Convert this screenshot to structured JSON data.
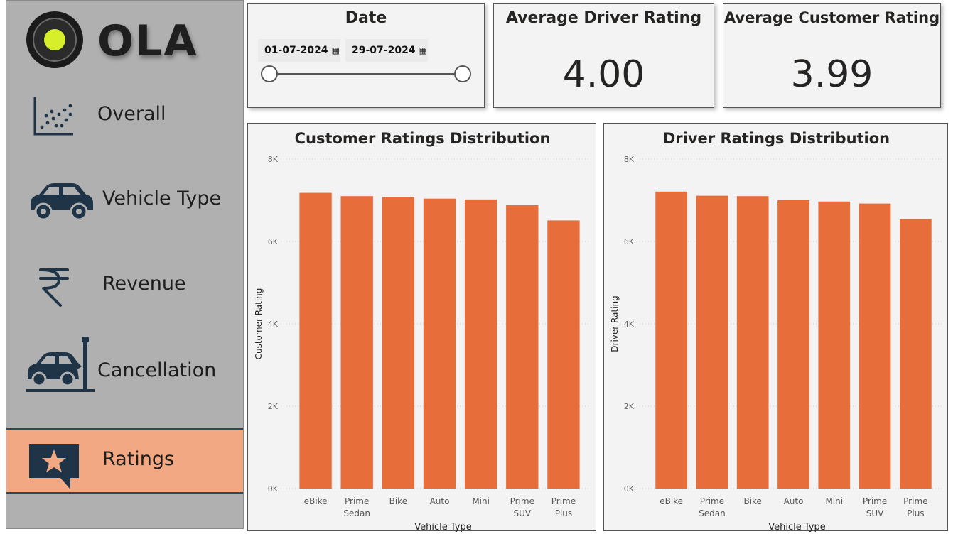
{
  "brand": {
    "name": "OLA"
  },
  "nav": {
    "items": [
      {
        "label": "Overall",
        "icon": "scatter-chart-icon"
      },
      {
        "label": "Vehicle Type",
        "icon": "car-icon"
      },
      {
        "label": "Revenue",
        "icon": "rupee-icon"
      },
      {
        "label": "Cancellation",
        "icon": "car-crash-icon"
      },
      {
        "label": "Ratings",
        "icon": "star-chat-icon",
        "active": true
      }
    ]
  },
  "date_filter": {
    "title": "Date",
    "start": "01-07-2024",
    "end": "29-07-2024",
    "range_start_fraction": 0,
    "range_end_fraction": 1
  },
  "kpis": {
    "avg_driver": {
      "title": "Average Driver Rating",
      "value": "4.00"
    },
    "avg_customer": {
      "title": "Average Customer Rating",
      "value": "3.99"
    }
  },
  "colors": {
    "bar": "#e76d3a",
    "accent": "#f2a882",
    "sidebar": "#b0b0b0",
    "navy": "#1f3447"
  },
  "chart_data": [
    {
      "type": "bar",
      "title": "Customer Ratings Distribution",
      "xlabel": "Vehicle Type",
      "ylabel": "Customer Rating",
      "categories": [
        "eBike",
        "Prime Sedan",
        "Bike",
        "Auto",
        "Mini",
        "Prime SUV",
        "Prime Plus"
      ],
      "values": [
        7180,
        7100,
        7080,
        7040,
        7020,
        6880,
        6510
      ],
      "ylim": [
        0,
        8000
      ],
      "yticks": [
        0,
        2000,
        4000,
        6000,
        8000
      ],
      "ytick_labels": [
        "0K",
        "2K",
        "4K",
        "6K",
        "8K"
      ],
      "grid": true
    },
    {
      "type": "bar",
      "title": "Driver Ratings Distribution",
      "xlabel": "Vehicle Type",
      "ylabel": "Driver Rating",
      "categories": [
        "eBike",
        "Prime Sedan",
        "Bike",
        "Auto",
        "Mini",
        "Prime SUV",
        "Prime Plus"
      ],
      "values": [
        7210,
        7110,
        7100,
        7000,
        6970,
        6920,
        6540
      ],
      "ylim": [
        0,
        8000
      ],
      "yticks": [
        0,
        2000,
        4000,
        6000,
        8000
      ],
      "ytick_labels": [
        "0K",
        "2K",
        "4K",
        "6K",
        "8K"
      ],
      "grid": true
    }
  ]
}
